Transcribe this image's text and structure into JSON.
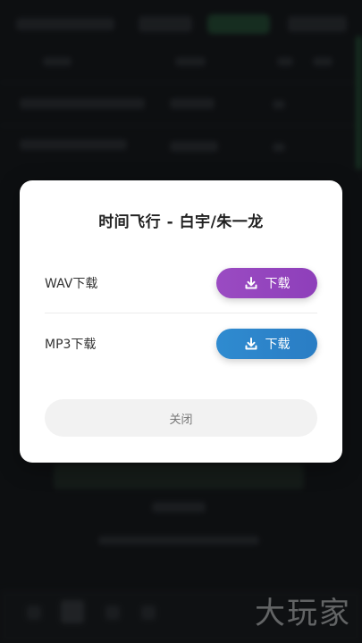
{
  "dialog": {
    "title": "时间飞行 - 白宇/朱一龙",
    "options": [
      {
        "label": "WAV下载",
        "button_label": "下载",
        "button_color": "#9a4bc2"
      },
      {
        "label": "MP3下载",
        "button_label": "下载",
        "button_color": "#2f8bd0"
      }
    ],
    "close_label": "关闭"
  },
  "watermark": {
    "text": "大玩家"
  },
  "icons": {
    "download": "download-icon"
  }
}
